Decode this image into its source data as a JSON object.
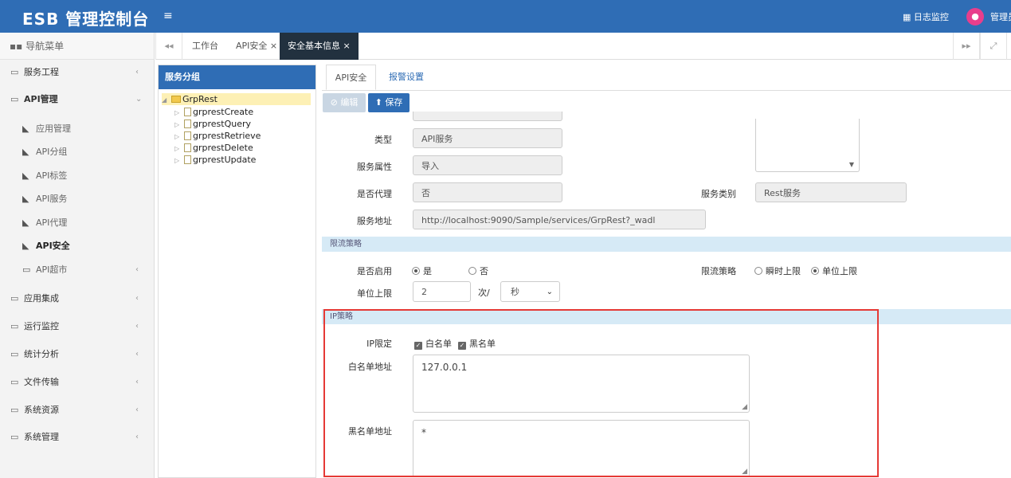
{
  "header": {
    "brand": "ESB 管理控制台",
    "menu_icon": "≡",
    "log_monitor": "日志监控",
    "admin": "管理员"
  },
  "sidebar": {
    "title": "导航菜单",
    "items": [
      {
        "label": "服务工程"
      },
      {
        "label": "API管理"
      },
      {
        "label": "应用管理"
      },
      {
        "label": "API分组"
      },
      {
        "label": "API标签"
      },
      {
        "label": "API服务"
      },
      {
        "label": "API代理"
      },
      {
        "label": "API安全"
      },
      {
        "label": "API超市"
      },
      {
        "label": "应用集成"
      },
      {
        "label": "运行监控"
      },
      {
        "label": "统计分析"
      },
      {
        "label": "文件传输"
      },
      {
        "label": "系统资源"
      },
      {
        "label": "系统管理"
      }
    ]
  },
  "tabs": [
    {
      "label": "工作台"
    },
    {
      "label": "API安全 ×"
    },
    {
      "label": "安全基本信息 ×"
    }
  ],
  "tree": {
    "title": "服务分组",
    "root": "GrpRest",
    "children": [
      "grprestCreate",
      "grprestQuery",
      "grprestRetrieve",
      "grprestDelete",
      "grprestUpdate"
    ]
  },
  "form": {
    "tabs": [
      "API安全",
      "报警设置"
    ],
    "edit_label": "编辑",
    "save_label": "保存",
    "fields": {
      "type_label": "类型",
      "type_value": "API服务",
      "attr_label": "服务属性",
      "attr_value": "导入",
      "proxy_label": "是否代理",
      "proxy_value": "否",
      "category_label": "服务类别",
      "category_value": "Rest服务",
      "address_label": "服务地址",
      "address_value": "http://localhost:9090/Sample/services/GrpRest?_wadl"
    },
    "rate": {
      "section": "限流策略",
      "enable_label": "是否启用",
      "yes": "是",
      "no": "否",
      "policy_label": "限流策略",
      "instant": "瞬时上限",
      "unit": "单位上限",
      "unit_label": "单位上限",
      "unit_value": "2",
      "per": "次/",
      "period": "秒"
    },
    "ip": {
      "section": "IP策略",
      "limit_label": "IP限定",
      "whitelist": "白名单",
      "blacklist": "黑名单",
      "white_label": "白名单地址",
      "white_value": "127.0.0.1",
      "black_label": "黑名单地址",
      "black_value": "*"
    }
  }
}
